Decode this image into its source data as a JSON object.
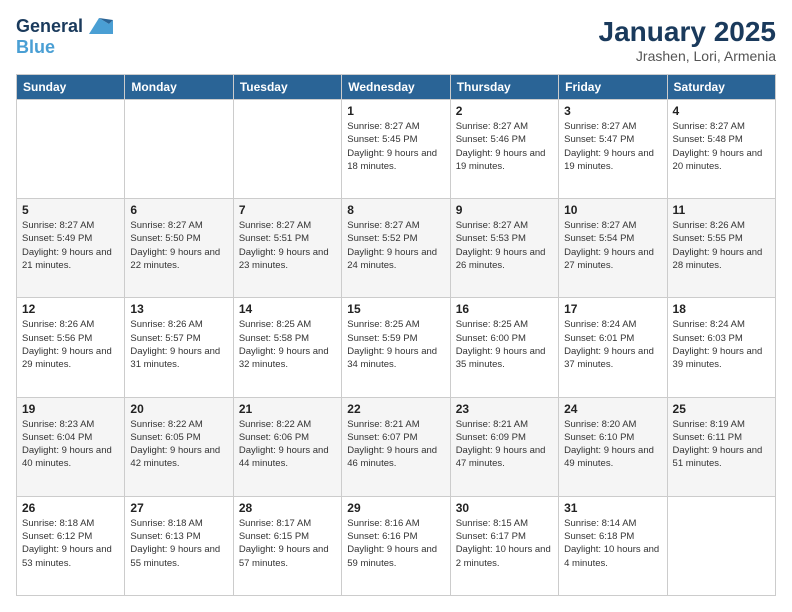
{
  "logo": {
    "line1": "General",
    "line2": "Blue"
  },
  "title": "January 2025",
  "subtitle": "Jrashen, Lori, Armenia",
  "days_of_week": [
    "Sunday",
    "Monday",
    "Tuesday",
    "Wednesday",
    "Thursday",
    "Friday",
    "Saturday"
  ],
  "weeks": [
    [
      {
        "day": "",
        "sunrise": "",
        "sunset": "",
        "daylight": ""
      },
      {
        "day": "",
        "sunrise": "",
        "sunset": "",
        "daylight": ""
      },
      {
        "day": "",
        "sunrise": "",
        "sunset": "",
        "daylight": ""
      },
      {
        "day": "1",
        "sunrise": "Sunrise: 8:27 AM",
        "sunset": "Sunset: 5:45 PM",
        "daylight": "Daylight: 9 hours and 18 minutes."
      },
      {
        "day": "2",
        "sunrise": "Sunrise: 8:27 AM",
        "sunset": "Sunset: 5:46 PM",
        "daylight": "Daylight: 9 hours and 19 minutes."
      },
      {
        "day": "3",
        "sunrise": "Sunrise: 8:27 AM",
        "sunset": "Sunset: 5:47 PM",
        "daylight": "Daylight: 9 hours and 19 minutes."
      },
      {
        "day": "4",
        "sunrise": "Sunrise: 8:27 AM",
        "sunset": "Sunset: 5:48 PM",
        "daylight": "Daylight: 9 hours and 20 minutes."
      }
    ],
    [
      {
        "day": "5",
        "sunrise": "Sunrise: 8:27 AM",
        "sunset": "Sunset: 5:49 PM",
        "daylight": "Daylight: 9 hours and 21 minutes."
      },
      {
        "day": "6",
        "sunrise": "Sunrise: 8:27 AM",
        "sunset": "Sunset: 5:50 PM",
        "daylight": "Daylight: 9 hours and 22 minutes."
      },
      {
        "day": "7",
        "sunrise": "Sunrise: 8:27 AM",
        "sunset": "Sunset: 5:51 PM",
        "daylight": "Daylight: 9 hours and 23 minutes."
      },
      {
        "day": "8",
        "sunrise": "Sunrise: 8:27 AM",
        "sunset": "Sunset: 5:52 PM",
        "daylight": "Daylight: 9 hours and 24 minutes."
      },
      {
        "day": "9",
        "sunrise": "Sunrise: 8:27 AM",
        "sunset": "Sunset: 5:53 PM",
        "daylight": "Daylight: 9 hours and 26 minutes."
      },
      {
        "day": "10",
        "sunrise": "Sunrise: 8:27 AM",
        "sunset": "Sunset: 5:54 PM",
        "daylight": "Daylight: 9 hours and 27 minutes."
      },
      {
        "day": "11",
        "sunrise": "Sunrise: 8:26 AM",
        "sunset": "Sunset: 5:55 PM",
        "daylight": "Daylight: 9 hours and 28 minutes."
      }
    ],
    [
      {
        "day": "12",
        "sunrise": "Sunrise: 8:26 AM",
        "sunset": "Sunset: 5:56 PM",
        "daylight": "Daylight: 9 hours and 29 minutes."
      },
      {
        "day": "13",
        "sunrise": "Sunrise: 8:26 AM",
        "sunset": "Sunset: 5:57 PM",
        "daylight": "Daylight: 9 hours and 31 minutes."
      },
      {
        "day": "14",
        "sunrise": "Sunrise: 8:25 AM",
        "sunset": "Sunset: 5:58 PM",
        "daylight": "Daylight: 9 hours and 32 minutes."
      },
      {
        "day": "15",
        "sunrise": "Sunrise: 8:25 AM",
        "sunset": "Sunset: 5:59 PM",
        "daylight": "Daylight: 9 hours and 34 minutes."
      },
      {
        "day": "16",
        "sunrise": "Sunrise: 8:25 AM",
        "sunset": "Sunset: 6:00 PM",
        "daylight": "Daylight: 9 hours and 35 minutes."
      },
      {
        "day": "17",
        "sunrise": "Sunrise: 8:24 AM",
        "sunset": "Sunset: 6:01 PM",
        "daylight": "Daylight: 9 hours and 37 minutes."
      },
      {
        "day": "18",
        "sunrise": "Sunrise: 8:24 AM",
        "sunset": "Sunset: 6:03 PM",
        "daylight": "Daylight: 9 hours and 39 minutes."
      }
    ],
    [
      {
        "day": "19",
        "sunrise": "Sunrise: 8:23 AM",
        "sunset": "Sunset: 6:04 PM",
        "daylight": "Daylight: 9 hours and 40 minutes."
      },
      {
        "day": "20",
        "sunrise": "Sunrise: 8:22 AM",
        "sunset": "Sunset: 6:05 PM",
        "daylight": "Daylight: 9 hours and 42 minutes."
      },
      {
        "day": "21",
        "sunrise": "Sunrise: 8:22 AM",
        "sunset": "Sunset: 6:06 PM",
        "daylight": "Daylight: 9 hours and 44 minutes."
      },
      {
        "day": "22",
        "sunrise": "Sunrise: 8:21 AM",
        "sunset": "Sunset: 6:07 PM",
        "daylight": "Daylight: 9 hours and 46 minutes."
      },
      {
        "day": "23",
        "sunrise": "Sunrise: 8:21 AM",
        "sunset": "Sunset: 6:09 PM",
        "daylight": "Daylight: 9 hours and 47 minutes."
      },
      {
        "day": "24",
        "sunrise": "Sunrise: 8:20 AM",
        "sunset": "Sunset: 6:10 PM",
        "daylight": "Daylight: 9 hours and 49 minutes."
      },
      {
        "day": "25",
        "sunrise": "Sunrise: 8:19 AM",
        "sunset": "Sunset: 6:11 PM",
        "daylight": "Daylight: 9 hours and 51 minutes."
      }
    ],
    [
      {
        "day": "26",
        "sunrise": "Sunrise: 8:18 AM",
        "sunset": "Sunset: 6:12 PM",
        "daylight": "Daylight: 9 hours and 53 minutes."
      },
      {
        "day": "27",
        "sunrise": "Sunrise: 8:18 AM",
        "sunset": "Sunset: 6:13 PM",
        "daylight": "Daylight: 9 hours and 55 minutes."
      },
      {
        "day": "28",
        "sunrise": "Sunrise: 8:17 AM",
        "sunset": "Sunset: 6:15 PM",
        "daylight": "Daylight: 9 hours and 57 minutes."
      },
      {
        "day": "29",
        "sunrise": "Sunrise: 8:16 AM",
        "sunset": "Sunset: 6:16 PM",
        "daylight": "Daylight: 9 hours and 59 minutes."
      },
      {
        "day": "30",
        "sunrise": "Sunrise: 8:15 AM",
        "sunset": "Sunset: 6:17 PM",
        "daylight": "Daylight: 10 hours and 2 minutes."
      },
      {
        "day": "31",
        "sunrise": "Sunrise: 8:14 AM",
        "sunset": "Sunset: 6:18 PM",
        "daylight": "Daylight: 10 hours and 4 minutes."
      },
      {
        "day": "",
        "sunrise": "",
        "sunset": "",
        "daylight": ""
      }
    ]
  ]
}
